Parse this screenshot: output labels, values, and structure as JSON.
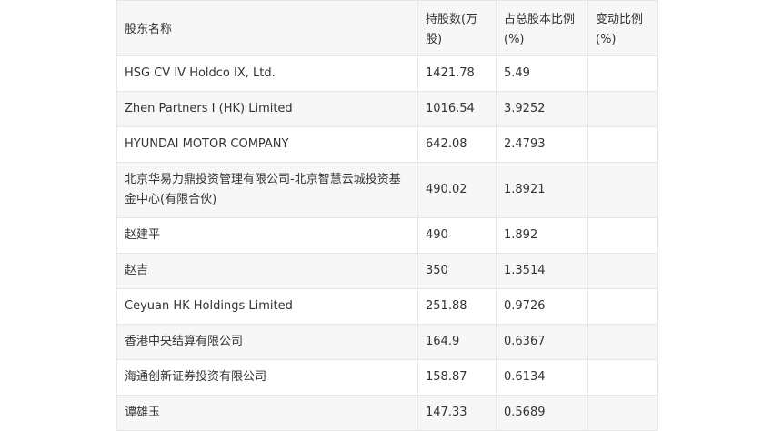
{
  "table": {
    "headers": [
      "股东名称",
      "持股数(万股)",
      "占总股本比例(%)",
      "变动比例(%)"
    ],
    "rows": [
      [
        "HSG CV IV Holdco IX, Ltd.",
        "1421.78",
        "5.49",
        ""
      ],
      [
        "Zhen Partners I (HK) Limited",
        "1016.54",
        "3.9252",
        ""
      ],
      [
        "HYUNDAI MOTOR COMPANY",
        "642.08",
        "2.4793",
        ""
      ],
      [
        "北京华易力鼎投资管理有限公司-北京智慧云城投资基金中心(有限合伙)",
        "490.02",
        "1.8921",
        ""
      ],
      [
        "赵建平",
        "490",
        "1.892",
        ""
      ],
      [
        "赵吉",
        "350",
        "1.3514",
        ""
      ],
      [
        "Ceyuan HK Holdings Limited",
        "251.88",
        "0.9726",
        ""
      ],
      [
        "香港中央结算有限公司",
        "164.9",
        "0.6367",
        ""
      ],
      [
        "海通创新证券投资有限公司",
        "158.87",
        "0.6134",
        ""
      ],
      [
        "谭雄玉",
        "147.33",
        "0.5689",
        ""
      ]
    ]
  }
}
